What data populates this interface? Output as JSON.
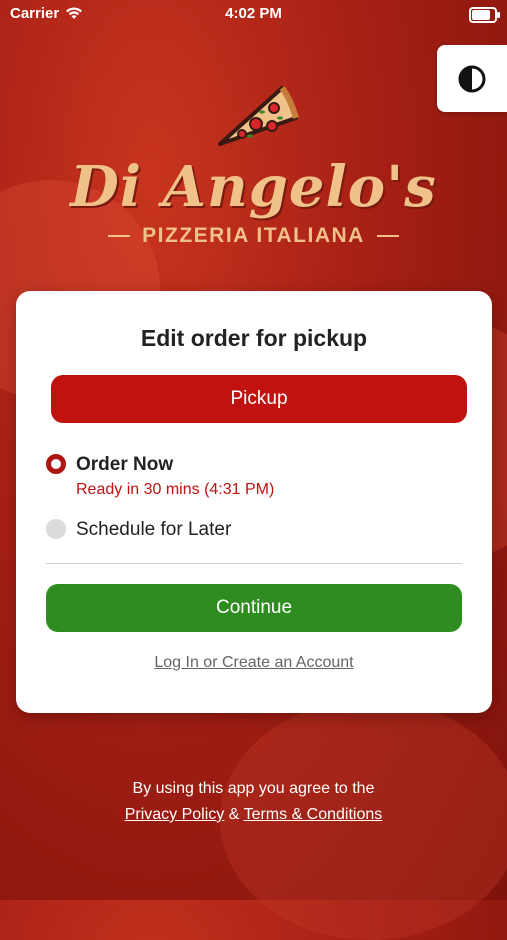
{
  "status_bar": {
    "carrier": "Carrier",
    "time": "4:02 PM",
    "battery_level": 1.0
  },
  "theme_toggle": {
    "icon": "contrast-icon"
  },
  "logo": {
    "icon": "pizza-slice-icon",
    "name": "Di Angelo's",
    "subtitle": "PIZZERIA ITALIANA"
  },
  "card": {
    "title": "Edit order for pickup",
    "pickup_label": "Pickup",
    "options": [
      {
        "label": "Order Now",
        "detail": "Ready in 30 mins (4:31 PM)",
        "selected": true
      },
      {
        "label": "Schedule for Later",
        "selected": false
      }
    ],
    "continue_label": "Continue",
    "login_label": "Log In or Create an Account"
  },
  "footer": {
    "agree_text": "By using this app you agree to the",
    "privacy_label": "Privacy Policy",
    "ampersand": "&",
    "terms_label": "Terms & Conditions"
  },
  "colors": {
    "brand_red": "#c0120f",
    "continue_green": "#2f8c20",
    "logo_gold": "#f0c189"
  }
}
